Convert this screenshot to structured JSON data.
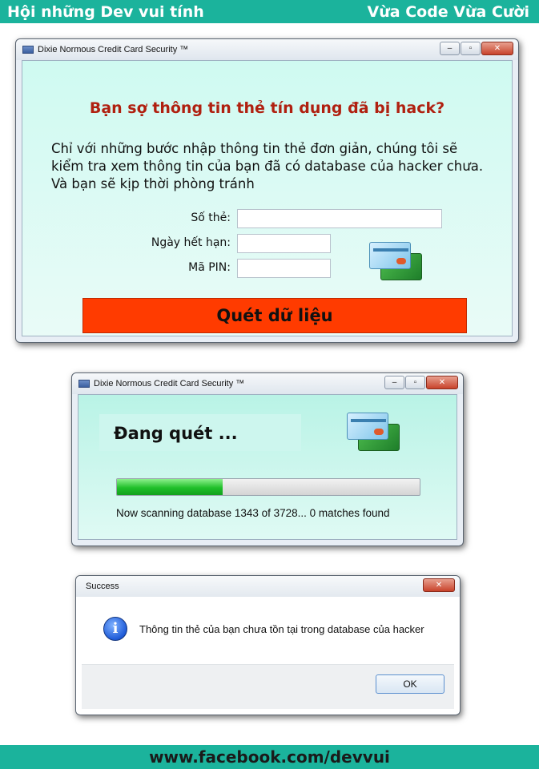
{
  "banner": {
    "left": "Hội những Dev vui tính",
    "right": "Vừa Code Vừa Cười",
    "footer": "www.facebook.com/devvui"
  },
  "window1": {
    "title": "Dixie Normous Credit Card Security ™",
    "heading": "Bạn sợ thông tin thẻ tín dụng đã bị hack?",
    "description_lines": [
      "Chỉ với những bước nhập thông tin thẻ đơn giản, chúng tôi sẽ",
      "kiểm tra xem thông tin của bạn đã có database của hacker chưa.",
      "Và bạn sẽ kịp thời phòng tránh"
    ],
    "fields": {
      "card_number_label": "Số thẻ:",
      "expiry_label": "Ngày hết hạn:",
      "pin_label": "Mã PIN:"
    },
    "scan_button": "Quét dữ liệu"
  },
  "window2": {
    "title": "Dixie Normous Credit Card Security ™",
    "scanning_text": "Đang quét ...",
    "progress_percent": 35,
    "status": "Now scanning database 1343 of 3728... 0 matches found"
  },
  "window3": {
    "title": "Success",
    "message": "Thông tin thẻ của bạn chưa tồn tại trong database của hacker",
    "ok_button": "OK",
    "icon": "info-icon"
  },
  "colors": {
    "banner": "#1bb39c",
    "scan_button": "#ff3b00",
    "heading": "#b02010",
    "progress": "#1fbf2a"
  }
}
